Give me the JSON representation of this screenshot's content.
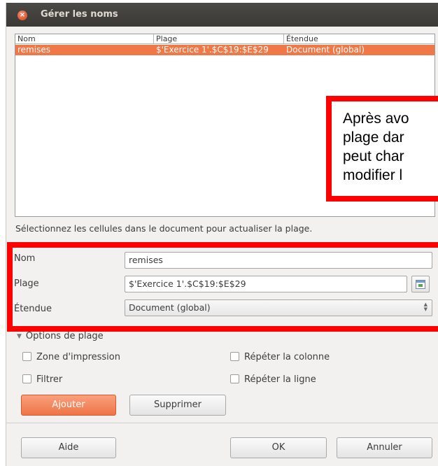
{
  "window": {
    "title": "Gérer les noms"
  },
  "names_list": {
    "columns": [
      "Nom",
      "Plage",
      "Étendue"
    ],
    "rows": [
      {
        "name": "remises",
        "range": "$'Exercice 1'.$C$19:$E$29",
        "scope": "Document (global)",
        "selected": true
      }
    ]
  },
  "callout": {
    "lines": [
      "Après avo",
      "plage dar",
      "peut char",
      "modifier l"
    ],
    "border_color": "#ff0000"
  },
  "hint": "Sélectionnez les cellules dans le document pour actualiser la plage.",
  "form": {
    "name_label": "Nom",
    "name_value": "remises",
    "range_label": "Plage",
    "range_value": "$'Exercice 1'.$C$19:$E$29",
    "scope_label": "Étendue",
    "scope_value": "Document (global)"
  },
  "options": {
    "expander_label": "Options de plage",
    "print_area": "Zone d'impression",
    "filter": "Filtrer",
    "repeat_column": "Répéter la colonne",
    "repeat_row": "Répéter la ligne"
  },
  "buttons": {
    "add": "Ajouter",
    "delete": "Supprimer",
    "help": "Aide",
    "ok": "OK",
    "cancel": "Annuler"
  },
  "colors": {
    "accent": "#f07746",
    "titlebar": "#3c3b37",
    "annotation": "#ff0000"
  }
}
